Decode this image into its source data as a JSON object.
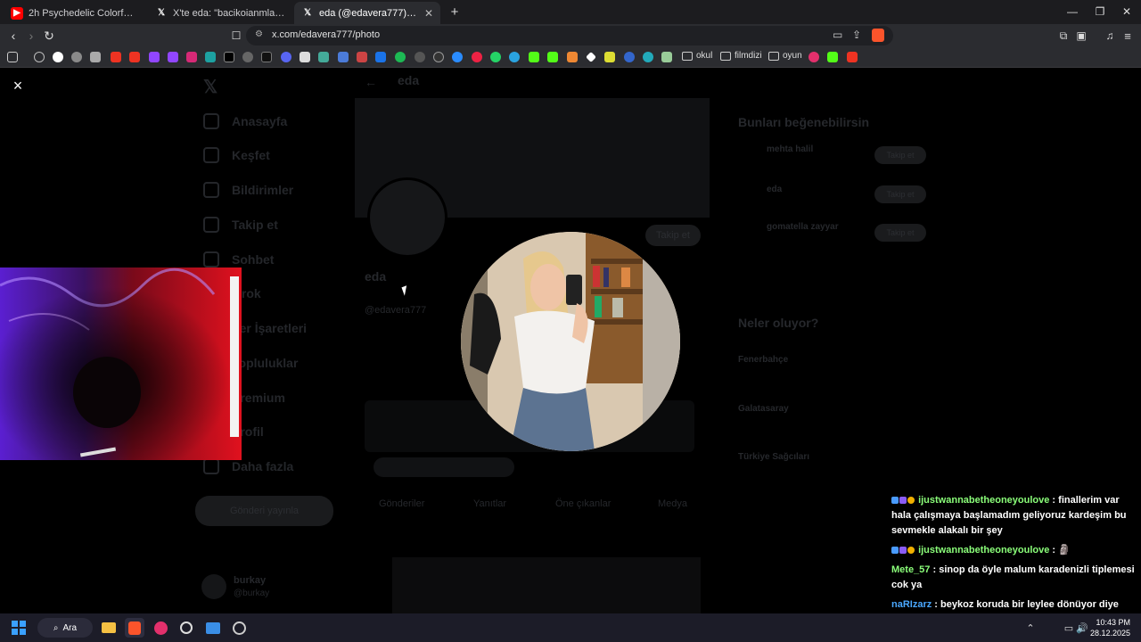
{
  "tabs": [
    {
      "title": "2h Psychedelic Colorful Neon Backgr",
      "favicon": "youtube-icon"
    },
    {
      "title": "X'te eda: \"bacikoianmla https://t.co/",
      "favicon": "x-icon"
    },
    {
      "title": "eda (@edavera777) / X",
      "favicon": "x-icon",
      "active": true
    }
  ],
  "window": {
    "minimize": "—",
    "restore": "❐",
    "close": "✕"
  },
  "address": {
    "url": "x.com/edavera777/photo"
  },
  "bookmarks": {
    "folders": [
      "okul",
      "filmdizi",
      "oyun"
    ]
  },
  "x_page": {
    "header_name": "eda",
    "nav": [
      "Anasayfa",
      "Keşfet",
      "Bildirimler",
      "Takip et",
      "Sohbet",
      "Grok",
      "Yer İşaretleri",
      "Topluluklar",
      "Premium",
      "Profil",
      "Daha fazla"
    ],
    "post_button": "Gönderi yayınla",
    "profile_name": "eda",
    "handle": "@edavera777",
    "edit_button": "Takip et",
    "suggest_title": "Bunları beğenebilirsin",
    "suggestions": [
      "mehta halil",
      "eda",
      "gomatella zayyar"
    ],
    "follow_label": "Takip et",
    "trends_title": "Neler oluyor?",
    "trends": [
      "Fenerbahçe",
      "Galatasaray",
      "Türkiye Sağcıları"
    ],
    "tabs": [
      "Gönderiler",
      "Yanıtlar",
      "Öne çıkanlar",
      "Medya"
    ],
    "footer_user": "burkay",
    "footer_handle": "@burkay"
  },
  "photo_viewer": {
    "close_label": "×"
  },
  "chat": [
    {
      "user": "ijustwannabetheoneyoulove",
      "color": "#8bff7a",
      "text": "finallerim var hala çalışmaya başlamadım geliyoruz kardeşim bu sevmekle alakalı bir şey"
    },
    {
      "user": "ijustwannabetheoneyoulove",
      "color": "#8bff7a",
      "text": "🗿"
    },
    {
      "user": "Mete_57",
      "color": "#8bff7a",
      "text": "sinop da öyle malum karadenizli tiplemesi cok ya"
    },
    {
      "user": "naRIzarz",
      "color": "#4aa8ff",
      "text": "beykoz koruda bir leylee dönüyor diye biliyorum"
    },
    {
      "user": "ijustwannabetheoneyoulove",
      "color": "#8bff7a",
      "text": "🗿"
    }
  ],
  "taskbar": {
    "search_label": "Ara",
    "time": "10:43 PM",
    "date": "28.12.2025"
  }
}
